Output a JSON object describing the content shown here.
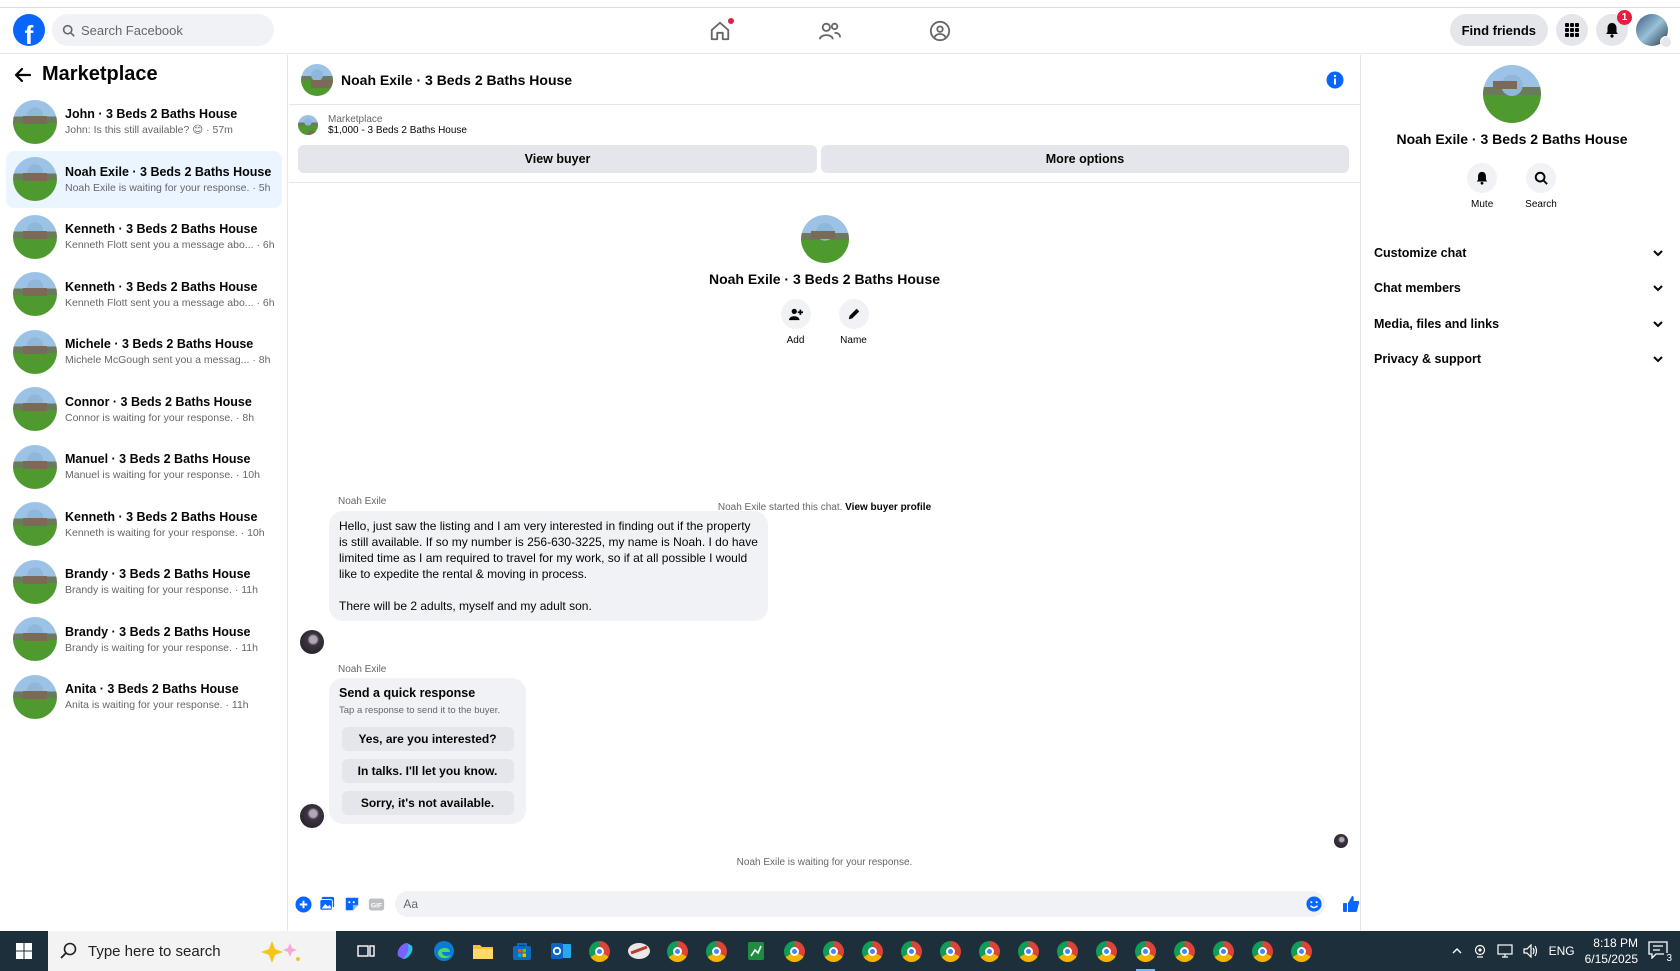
{
  "topbar": {
    "search_placeholder": "Search Facebook",
    "find_friends": "Find friends",
    "notification_count": "1"
  },
  "sidebar": {
    "title": "Marketplace",
    "items": [
      {
        "title": "John · 3 Beds 2 Baths House",
        "sub": "John: Is this still available? 😊 · 57m"
      },
      {
        "title": "Noah Exile · 3 Beds 2 Baths House",
        "sub": "Noah Exile is waiting for your response. · 5h"
      },
      {
        "title": "Kenneth · 3 Beds 2 Baths House",
        "sub": "Kenneth Flott sent you a message abo... · 6h"
      },
      {
        "title": "Kenneth · 3 Beds 2 Baths House",
        "sub": "Kenneth Flott sent you a message abo... · 6h"
      },
      {
        "title": "Michele · 3 Beds 2 Baths House",
        "sub": "Michele McGough sent you a messag... · 8h"
      },
      {
        "title": "Connor · 3 Beds 2 Baths House",
        "sub": "Connor is waiting for your response. · 8h"
      },
      {
        "title": "Manuel · 3 Beds 2 Baths House",
        "sub": "Manuel is waiting for your response. · 10h"
      },
      {
        "title": "Kenneth · 3 Beds 2 Baths House",
        "sub": "Kenneth is waiting for your response. · 10h"
      },
      {
        "title": "Brandy · 3 Beds 2 Baths House",
        "sub": "Brandy is waiting for your response. · 11h"
      },
      {
        "title": "Brandy · 3 Beds 2 Baths House",
        "sub": "Brandy is waiting for your response. · 11h"
      },
      {
        "title": "Anita · 3 Beds 2 Baths House",
        "sub": "Anita is waiting for your response. · 11h"
      }
    ]
  },
  "chat": {
    "title": "Noah Exile · 3 Beds 2 Baths House",
    "listing_label": "Marketplace",
    "listing_price_title": "$1,000 - 3 Beds 2 Baths House",
    "view_buyer": "View buyer",
    "more_options": "More options",
    "center_title": "Noah Exile · 3 Beds 2 Baths House",
    "add_label": "Add",
    "name_label": "Name",
    "started_text": "Noah Exile started this chat.",
    "view_buyer_profile": "View buyer profile",
    "sender_name": "Noah Exile",
    "message_p1": "Hello, just saw the listing and I am very interested in finding out if the property is still available. If so my number is 256-630-3225, my name is Noah. I do have limited time as I am required to travel for my work, so if at all possible I would like to expedite the rental & moving in process.",
    "message_p2": "There will be 2 adults, myself and my adult son.",
    "quick_title": "Send a quick response",
    "quick_sub": "Tap a response to send it to the buyer.",
    "quick_replies": [
      "Yes, are you interested?",
      "In talks. I'll let you know.",
      "Sorry, it's not available."
    ],
    "waiting_text": "Noah Exile is waiting for your response.",
    "composer_placeholder": "Aa"
  },
  "details": {
    "title": "Noah Exile · 3 Beds 2 Baths House",
    "mute": "Mute",
    "search": "Search",
    "sections": [
      "Customize chat",
      "Chat members",
      "Media, files and links",
      "Privacy & support"
    ]
  },
  "taskbar": {
    "search_placeholder": "Type here to search",
    "language": "ENG",
    "time": "8:18 PM",
    "date": "6/15/2025",
    "notification_count": "3"
  },
  "colors": {
    "brand_blue": "#0866ff",
    "active_item_bg": "#ebf5ff",
    "taskbar": "#1e2f3c"
  }
}
